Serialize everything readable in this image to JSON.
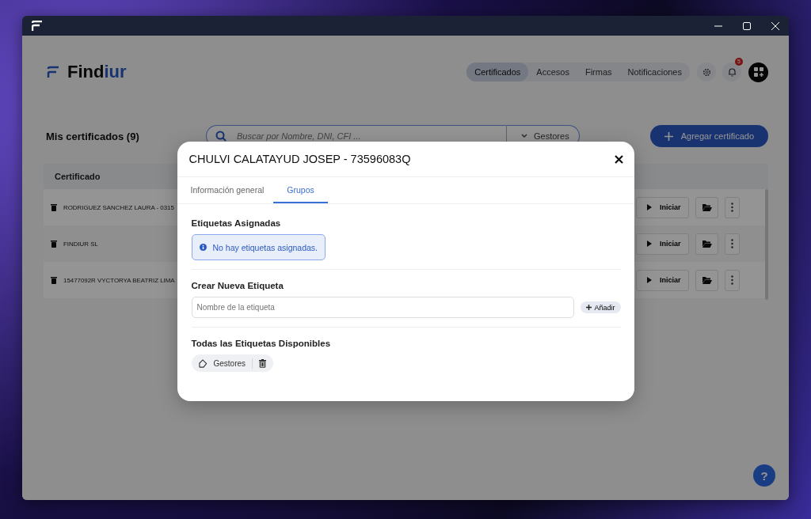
{
  "app": {
    "logo": {
      "text": "Find",
      "accent": "iur"
    },
    "nav": [
      {
        "label": "Certificados",
        "selected": true
      },
      {
        "label": "Accesos",
        "selected": false
      },
      {
        "label": "Firmas",
        "selected": false
      },
      {
        "label": "Notificaciones",
        "selected": false
      }
    ],
    "notification_count": "5",
    "page_title": "Mis certificados (9)",
    "search": {
      "placeholder": "Buscar por Nombre, DNI, CFI ...",
      "filter": "Gestores"
    },
    "add_button": "Agregar certificado",
    "table": {
      "columns": [
        "Certificado"
      ],
      "rows": [
        {
          "name": "RODRIGUEZ SANCHEZ LAURA - 0315",
          "action": "Iniciar"
        },
        {
          "name": "FINDIUR SL",
          "action": "Iniciar"
        },
        {
          "name": "15477092R VYCTORYA BEATRIZ LIMA",
          "action": "Iniciar"
        }
      ]
    },
    "help": "?"
  },
  "modal": {
    "title": "CHULVI CALATAYUD JOSEP - 73596083Q",
    "tabs": [
      {
        "label": "Información general",
        "selected": false
      },
      {
        "label": "Grupos",
        "selected": true
      }
    ],
    "assigned": {
      "heading": "Etiquetas Asignadas",
      "empty_message": "No hay etiquetas asignadas."
    },
    "create": {
      "heading": "Crear Nueva Etiqueta",
      "placeholder": "Nombre de la etiqueta",
      "button": "Añadir"
    },
    "available": {
      "heading": "Todas las Etiquetas Disponibles",
      "tags": [
        {
          "label": "Gestores"
        }
      ]
    }
  }
}
